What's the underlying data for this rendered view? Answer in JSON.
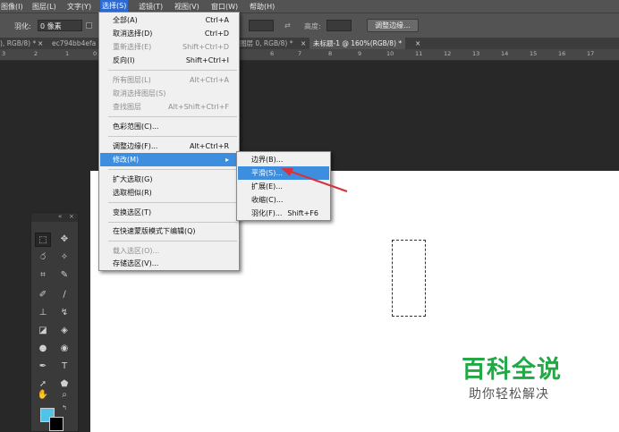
{
  "menubar": {
    "items": [
      "图像(I)",
      "图层(L)",
      "文字(Y)",
      "选择(S)",
      "滤镜(T)",
      "视图(V)",
      "窗口(W)",
      "帮助(H)"
    ],
    "active_index": 3
  },
  "options_bar": {
    "feather_label": "羽化:",
    "feather_value": "0 像素",
    "height_label": "高度:",
    "refine_edge_button": "调整边缘..."
  },
  "tabs": [
    "), RGB/8) *",
    "ec794bb4efa",
    "图层 0, RGB/8) *",
    "未标题-1 @ 160%(RGB/8) *"
  ],
  "ruler": {
    "numbers": [
      "3",
      "2",
      "1",
      "0",
      "6",
      "7",
      "8",
      "9",
      "10",
      "11",
      "12",
      "13",
      "14",
      "15",
      "16",
      "17"
    ]
  },
  "select_menu": {
    "items": [
      {
        "label": "全部(A)",
        "shortcut": "Ctrl+A",
        "disabled": false
      },
      {
        "label": "取消选择(D)",
        "shortcut": "Ctrl+D",
        "disabled": false
      },
      {
        "label": "重新选择(E)",
        "shortcut": "Shift+Ctrl+D",
        "disabled": true
      },
      {
        "label": "反向(I)",
        "shortcut": "Shift+Ctrl+I",
        "disabled": false
      },
      {
        "label": "所有图层(L)",
        "shortcut": "Alt+Ctrl+A",
        "disabled": true
      },
      {
        "label": "取消选择图层(S)",
        "shortcut": "",
        "disabled": true
      },
      {
        "label": "查找图层",
        "shortcut": "Alt+Shift+Ctrl+F",
        "disabled": true
      },
      {
        "label": "色彩范围(C)...",
        "shortcut": "",
        "disabled": false
      },
      {
        "label": "调整边缘(F)...",
        "shortcut": "Alt+Ctrl+R",
        "disabled": false
      },
      {
        "label": "修改(M)",
        "shortcut": "",
        "disabled": false,
        "highlighted": true,
        "submenu": true
      },
      {
        "label": "扩大选取(G)",
        "shortcut": "",
        "disabled": false
      },
      {
        "label": "选取相似(R)",
        "shortcut": "",
        "disabled": false
      },
      {
        "label": "变换选区(T)",
        "shortcut": "",
        "disabled": false
      },
      {
        "label": "在快速蒙版模式下编辑(Q)",
        "shortcut": "",
        "disabled": false
      },
      {
        "label": "载入选区(O)...",
        "shortcut": "",
        "disabled": true
      },
      {
        "label": "存储选区(V)...",
        "shortcut": "",
        "disabled": false
      }
    ]
  },
  "modify_submenu": {
    "items": [
      {
        "label": "边界(B)...",
        "shortcut": ""
      },
      {
        "label": "平滑(S)...",
        "shortcut": "",
        "highlighted": true
      },
      {
        "label": "扩展(E)...",
        "shortcut": ""
      },
      {
        "label": "收缩(C)...",
        "shortcut": ""
      },
      {
        "label": "羽化(F)...",
        "shortcut": "Shift+F6"
      }
    ]
  },
  "watermark": {
    "title": "百科全说",
    "subtitle": "助你轻松解决"
  },
  "colors": {
    "accent": "#3e8ee0",
    "arrow": "#d8323c",
    "foreground_swatch": "#4fc3e8",
    "watermark_green": "#22a845"
  }
}
